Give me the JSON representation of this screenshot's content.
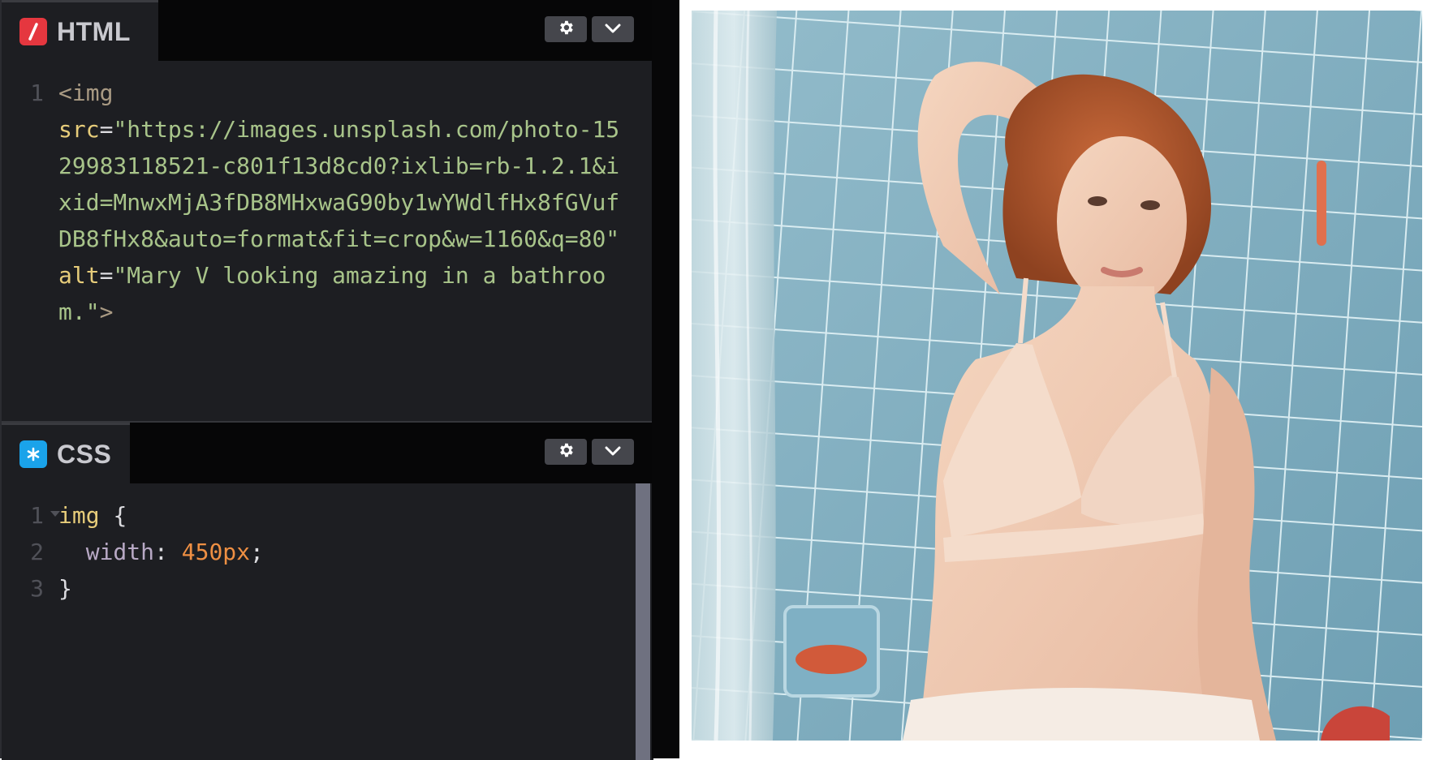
{
  "html_editor": {
    "title": "HTML",
    "icon": "html-slash-icon",
    "line_numbers": [
      "1"
    ],
    "code": {
      "tag_open": "<img",
      "src_attr": "src",
      "src_value": "\"https://images.unsplash.com/photo-1529983118521-c801f13d8cd0?ixlib=rb-1.2.1&ixid=MnwxMjA3fDB8MHxwaG90by1wYWdlfHx8fGVufDB8fHx8&auto=format&fit=crop&w=1160&q=80\"",
      "alt_attr": "alt",
      "alt_value": "\"Mary V looking amazing in a bathroom.\"",
      "tag_close": ">"
    }
  },
  "css_editor": {
    "title": "CSS",
    "icon": "asterisk-icon",
    "line_numbers": [
      "1",
      "2",
      "3"
    ],
    "code": {
      "selector": "img",
      "open_brace": "{",
      "property": "width",
      "value": "450px",
      "close_brace": "}"
    }
  },
  "buttons": {
    "settings_icon": "gear-icon",
    "collapse_icon": "chevron-down-icon"
  },
  "colors": {
    "html_badge": "#e5373f",
    "css_badge": "#1aa3ea",
    "editor_bg": "#1d1e22",
    "header_bg": "#060607"
  }
}
